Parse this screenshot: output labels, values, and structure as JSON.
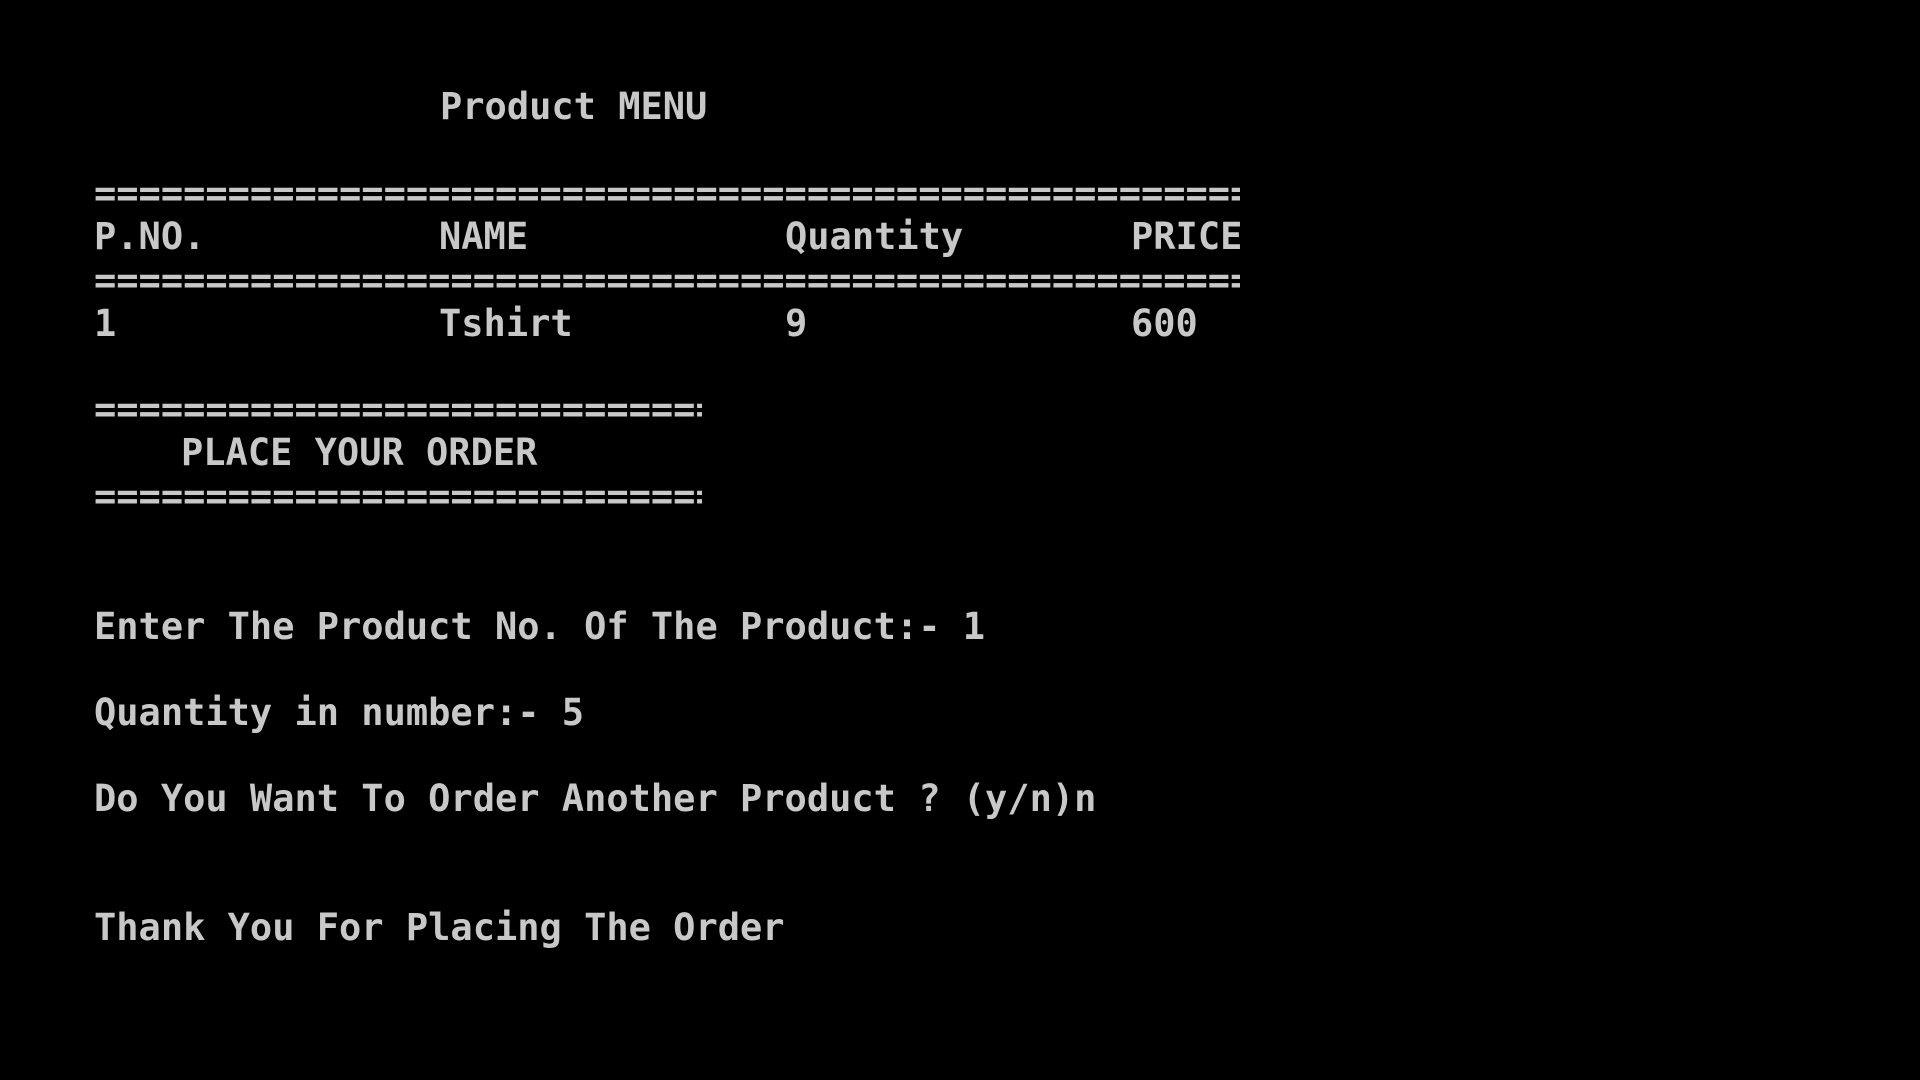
{
  "menu": {
    "title": "Product MENU",
    "separator_long": "=====================================================",
    "separator_short": "============================",
    "headers": {
      "pno": "P.NO.",
      "name": "NAME",
      "quantity": "Quantity",
      "price": "PRICE"
    },
    "rows": [
      {
        "pno": "1",
        "name": "Tshirt",
        "quantity": "9",
        "price": "600"
      }
    ]
  },
  "order": {
    "heading": "PLACE YOUR ORDER",
    "product_prompt": "Enter The Product No. Of The Product:- 1",
    "quantity_prompt": "Quantity in number:- 5",
    "another_prompt": "Do You Want To Order Another Product ? (y/n)n",
    "thank_you": "Thank You For Placing The Order"
  },
  "colors": {
    "background": "#000000",
    "text": "#c8c8c8"
  }
}
